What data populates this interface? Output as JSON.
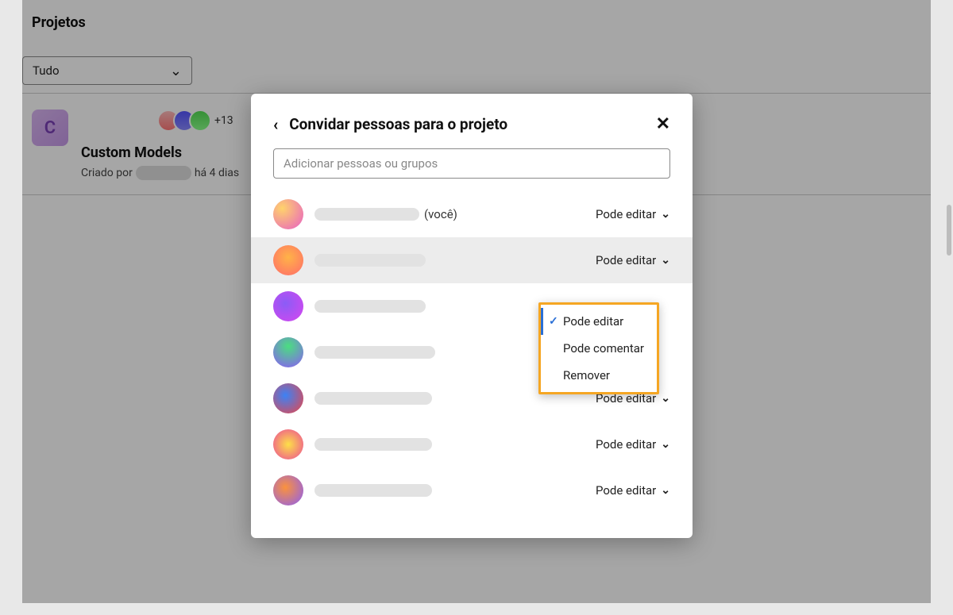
{
  "page": {
    "section_title": "Projetos",
    "filter_label": "Tudo"
  },
  "project_card": {
    "thumb_letter": "C",
    "extra_count": "+13",
    "title": "Custom Models",
    "created_prefix": "Criado por",
    "created_suffix": "há 4 dias"
  },
  "modal": {
    "title": "Convidar pessoas para o projeto",
    "search_placeholder": "Adicionar pessoas ou grupos",
    "you_suffix": "(você)",
    "permission_label": "Pode editar",
    "menu": {
      "edit": "Pode editar",
      "comment": "Pode comentar",
      "remove": "Remover"
    },
    "members": [
      {
        "pill_w": 132,
        "is_you": true,
        "avatar": "av-0",
        "show_perm": true,
        "hover": false
      },
      {
        "pill_w": 140,
        "is_you": false,
        "avatar": "av-1",
        "show_perm": true,
        "hover": true
      },
      {
        "pill_w": 140,
        "is_you": false,
        "avatar": "av-2",
        "show_perm": false,
        "hover": false
      },
      {
        "pill_w": 152,
        "is_you": false,
        "avatar": "av-3",
        "show_perm": false,
        "hover": false
      },
      {
        "pill_w": 148,
        "is_you": false,
        "avatar": "av-4",
        "show_perm": true,
        "hover": false
      },
      {
        "pill_w": 148,
        "is_you": false,
        "avatar": "av-5",
        "show_perm": true,
        "hover": false
      },
      {
        "pill_w": 148,
        "is_you": false,
        "avatar": "av-6",
        "show_perm": true,
        "hover": false
      }
    ]
  }
}
